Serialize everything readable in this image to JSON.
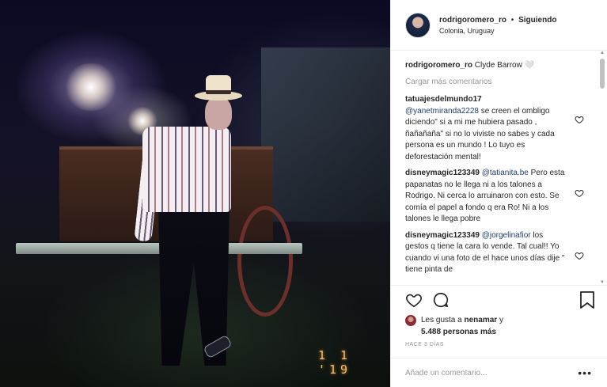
{
  "post": {
    "username": "rodrigoromero_ro",
    "separator": "•",
    "follow_status": "Siguiendo",
    "location": "Colonia, Uruguay",
    "photo_date_stamp": "1 1 '19"
  },
  "caption": {
    "username": "rodrigoromero_ro",
    "text": "Clyde Barrow 🤍"
  },
  "load_more_label": "Cargar más comentarios",
  "comments": [
    {
      "username": "tatuajesdelmundo17",
      "mention": "@yanetmiranda2228",
      "text": "se creen el ombligo diciendo\" si a mi me hubiera pasado , ñañañaña\" si no lo viviste no sabes y cada persona es un mundo ! Lo tuyo es deforestación mental!"
    },
    {
      "username": "disneymagic123349",
      "mention": "@tatianita.be",
      "text": "Pero esta papanatas no le llega ni a los talones a Rodrigo. Ni cerca lo arruinaron con esto. Se comía el papel a fondo q era Ro! Ni a los talones le llega pobre"
    },
    {
      "username": "disneymagic123349",
      "mention": "@jorgelinafior",
      "text": "los gestos q tiene la cara lo vende. Tal cual!! Yo cuando vi una foto de el hace unos días dije \" tiene pinta de"
    }
  ],
  "likes": {
    "prefix": "Les gusta a",
    "first_user": "nenamar",
    "connector": "y",
    "count_text": "5.488 personas más"
  },
  "time_ago": "HACE 3 DÍAS",
  "add_comment_placeholder": "Añade un comentario...",
  "more_options_label": "•••",
  "icons": {
    "like": "heart-icon",
    "comment": "comment-icon",
    "save": "bookmark-icon",
    "comment_like": "heart-icon"
  },
  "colors": {
    "text": "#262626",
    "muted": "#999999",
    "mention": "#1f3e6b",
    "date_stamp": "#f7c06a"
  }
}
